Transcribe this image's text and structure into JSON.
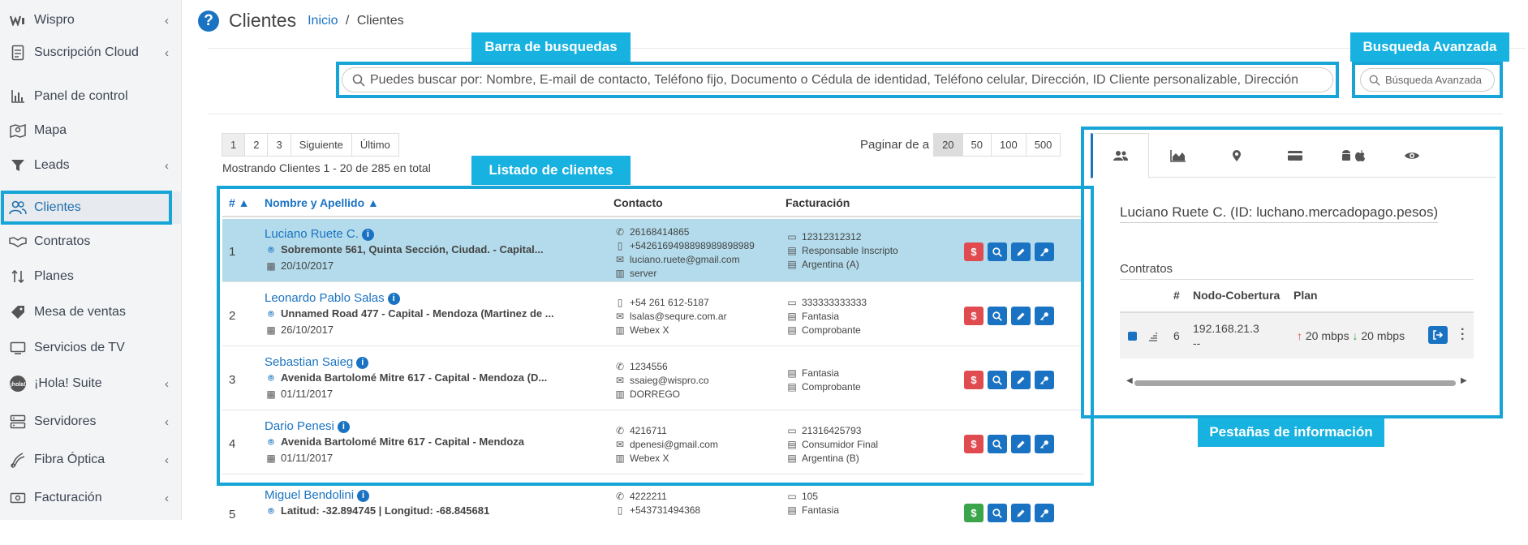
{
  "sidebar": {
    "items": [
      {
        "label": "Wispro",
        "icon": "wispro-logo-icon",
        "chevron": "‹"
      },
      {
        "label": "Suscripción Cloud",
        "icon": "document-icon",
        "chevron": "‹"
      },
      {
        "label": "Panel de control",
        "icon": "bar-chart-icon"
      },
      {
        "label": "Mapa",
        "icon": "map-icon"
      },
      {
        "label": "Leads",
        "icon": "funnel-icon",
        "chevron": "‹"
      },
      {
        "label": "Clientes",
        "icon": "users-icon",
        "active": true
      },
      {
        "label": "Contratos",
        "icon": "handshake-icon"
      },
      {
        "label": "Planes",
        "icon": "arrows-updown-icon"
      },
      {
        "label": "Mesa de ventas",
        "icon": "tag-icon"
      },
      {
        "label": "Servicios de TV",
        "icon": "tv-icon"
      },
      {
        "label": "¡Hola! Suite",
        "icon": "hola-icon",
        "chevron": "‹"
      },
      {
        "label": "Servidores",
        "icon": "server-icon",
        "chevron": "‹"
      },
      {
        "label": "Fibra Óptica",
        "icon": "fiber-icon",
        "chevron": "‹"
      },
      {
        "label": "Facturación",
        "icon": "billing-icon",
        "chevron": "‹"
      }
    ]
  },
  "header": {
    "title": "Clientes",
    "breadcrumb_home": "Inicio",
    "breadcrumb_sep": "/",
    "breadcrumb_current": "Clientes"
  },
  "annotations": {
    "search": "Barra de busquedas",
    "advanced": "Busqueda Avanzada",
    "list": "Listado de clientes",
    "tabs": "Pestañas de información"
  },
  "search": {
    "placeholder": "Puedes buscar por: Nombre, E-mail de contacto, Teléfono fijo, Documento o Cédula de identidad, Teléfono celular, Dirección, ID Cliente personalizable, Dirección",
    "advanced_label": "Búsqueda Avanzada"
  },
  "pagination": {
    "pages": [
      "1",
      "2",
      "3",
      "Siguiente",
      "Último"
    ],
    "showing": "Mostrando Clientes 1 - 20 de 285 en total",
    "per_page_label": "Paginar de a",
    "per_page": [
      "20",
      "50",
      "100",
      "500"
    ]
  },
  "table": {
    "headers": {
      "num": "# ▲",
      "name": "Nombre y Apellido ▲",
      "contact": "Contacto",
      "billing": "Facturación"
    },
    "rows": [
      {
        "num": "1",
        "name": "Luciano Ruete C.",
        "address": "Sobremonte 561, Quinta Sección, Ciudad. - Capital...",
        "date": "20/10/2017",
        "contact": [
          "26168414865",
          "+5426169498898989898989",
          "luciano.ruete@gmail.com",
          "server"
        ],
        "billing": [
          "12312312312",
          "Responsable Inscripto",
          "Argentina (A)"
        ],
        "pay": "red"
      },
      {
        "num": "2",
        "name": "Leonardo Pablo Salas",
        "address": "Unnamed Road 477 - Capital - Mendoza (Martinez de ...",
        "date": "26/10/2017",
        "contact": [
          "+54 261 612-5187",
          "lsalas@sequre.com.ar",
          "Webex X"
        ],
        "billing": [
          "333333333333",
          "Fantasia",
          "Comprobante"
        ],
        "pay": "red"
      },
      {
        "num": "3",
        "name": "Sebastian Saieg",
        "address": "Avenida Bartolomé Mitre 617 - Capital - Mendoza (D...",
        "date": "01/11/2017",
        "contact": [
          "1234556",
          "ssaieg@wispro.co",
          "DORREGO"
        ],
        "billing": [
          "Fantasia",
          "Comprobante"
        ],
        "pay": "red"
      },
      {
        "num": "4",
        "name": "Dario Penesi",
        "address": "Avenida Bartolomé Mitre 617 - Capital - Mendoza",
        "date": "01/11/2017",
        "contact": [
          "4216711",
          "dpenesi@gmail.com",
          "Webex X"
        ],
        "billing": [
          "21316425793",
          "Consumidor Final",
          "Argentina (B)"
        ],
        "pay": "red"
      },
      {
        "num": "5",
        "name": "Miguel Bendolini",
        "address": "Latitud: -32.894745 | Longitud: -68.845681",
        "date": "",
        "contact": [
          "4222211",
          "+543731494368"
        ],
        "billing": [
          "105",
          "Fantasia"
        ],
        "pay": "green"
      }
    ]
  },
  "panel": {
    "client_name": "Luciano Ruete C. (ID: luchano.mercadopago.pesos)",
    "contracts_title": "Contratos",
    "headers": {
      "num": "#",
      "node": "Nodo-Cobertura",
      "plan": "Plan"
    },
    "contract": {
      "num": "6",
      "ip": "192.168.21.3",
      "node": "--",
      "up": "20 mbps",
      "down": "20 mbps"
    },
    "tabs": [
      "users-icon",
      "area-chart-icon",
      "map-marker-icon",
      "credit-card-icon",
      "android-apple-icon",
      "eye-icon"
    ]
  },
  "colors": {
    "accent": "#16a5d6",
    "link": "#1a73c2",
    "danger": "#e04b4f",
    "success": "#3aa54a",
    "selected_row": "#b3dbeb"
  }
}
